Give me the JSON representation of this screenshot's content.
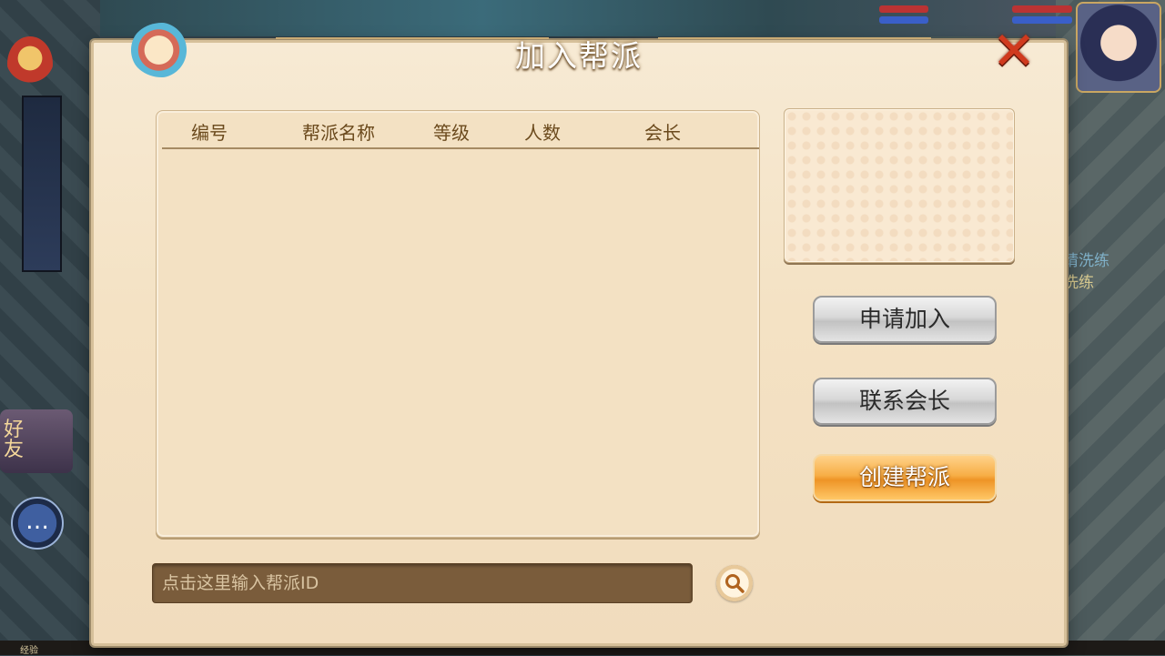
{
  "background": {
    "friend_label": "好友",
    "chat_icon": "…",
    "exp_label": "经验",
    "side_text_1": "请洗练",
    "side_text_2": "洗练"
  },
  "dialog": {
    "title": "加入帮派",
    "close_icon": "close-x-icon"
  },
  "table": {
    "columns": [
      "编号",
      "帮派名称",
      "等级",
      "人数",
      "会长"
    ],
    "rows": []
  },
  "actions": {
    "apply_label": "申请加入",
    "contact_label": "联系会长",
    "create_label": "创建帮派"
  },
  "search": {
    "placeholder": "点击这里输入帮派ID",
    "value": ""
  },
  "colors": {
    "accent_orange": "#f7ae46",
    "panel_bg": "#f3e1c3",
    "header_text": "#6b4a1d",
    "close_red": "#d03a1e"
  }
}
